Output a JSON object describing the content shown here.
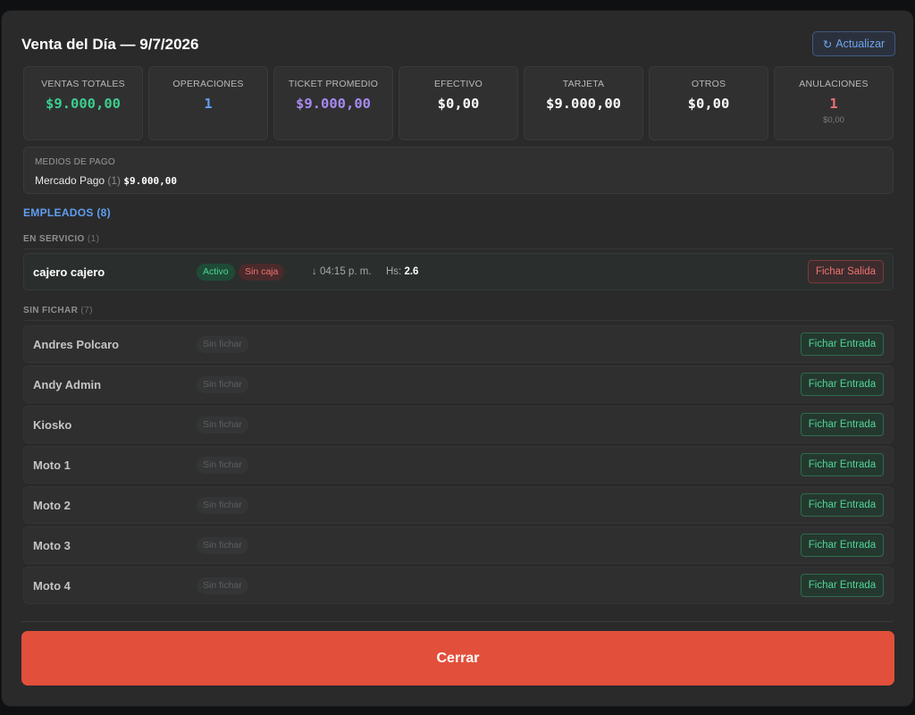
{
  "header": {
    "title": "Venta del Día — 9/7/2026",
    "refresh_icon": "↻",
    "refresh_label": "Actualizar"
  },
  "stats": [
    {
      "label": "VENTAS TOTALES",
      "value": "$9.000,00",
      "color": "#3ccf8e"
    },
    {
      "label": "OPERACIONES",
      "value": "1",
      "color": "#5f9ef0"
    },
    {
      "label": "TICKET PROMEDIO",
      "value": "$9.000,00",
      "color": "#a98af2"
    },
    {
      "label": "EFECTIVO",
      "value": "$0,00",
      "color": "#ffffff"
    },
    {
      "label": "TARJETA",
      "value": "$9.000,00",
      "color": "#ffffff"
    },
    {
      "label": "OTROS",
      "value": "$0,00",
      "color": "#ffffff"
    },
    {
      "label": "ANULACIONES",
      "value": "1",
      "color": "#f07070",
      "sub": "$0,00"
    }
  ],
  "payments": {
    "label": "MEDIOS DE PAGO",
    "method": "Mercado Pago",
    "count": "(1)",
    "amount": "$9.000,00"
  },
  "employees": {
    "heading": "EMPLEADOS (8)",
    "in_service_label": "EN SERVICIO",
    "in_service_count": "(1)",
    "in_service": [
      {
        "name": "cajero cajero",
        "badge_active": "Activo",
        "badge_nocash": "Sin caja",
        "time": "↓ 04:15 p. m.",
        "hours_label": "Hs:",
        "hours": "2.6",
        "action": "Fichar Salida"
      }
    ],
    "not_clocked_label": "SIN FICHAR",
    "not_clocked_count": "(7)",
    "not_clocked": [
      {
        "name": "Andres Polcaro",
        "badge": "Sin fichar",
        "action": "Fichar Entrada"
      },
      {
        "name": "Andy Admin",
        "badge": "Sin fichar",
        "action": "Fichar Entrada"
      },
      {
        "name": "Kiosko",
        "badge": "Sin fichar",
        "action": "Fichar Entrada"
      },
      {
        "name": "Moto 1",
        "badge": "Sin fichar",
        "action": "Fichar Entrada"
      },
      {
        "name": "Moto 2",
        "badge": "Sin fichar",
        "action": "Fichar Entrada"
      },
      {
        "name": "Moto 3",
        "badge": "Sin fichar",
        "action": "Fichar Entrada"
      },
      {
        "name": "Moto 4",
        "badge": "Sin fichar",
        "action": "Fichar Entrada"
      }
    ]
  },
  "footer": {
    "close_label": "Cerrar"
  },
  "colors": {
    "accent_blue": "#5f9ef0",
    "success_green": "#4fd693",
    "danger_red": "#f07272",
    "close_button": "#e2503b"
  }
}
